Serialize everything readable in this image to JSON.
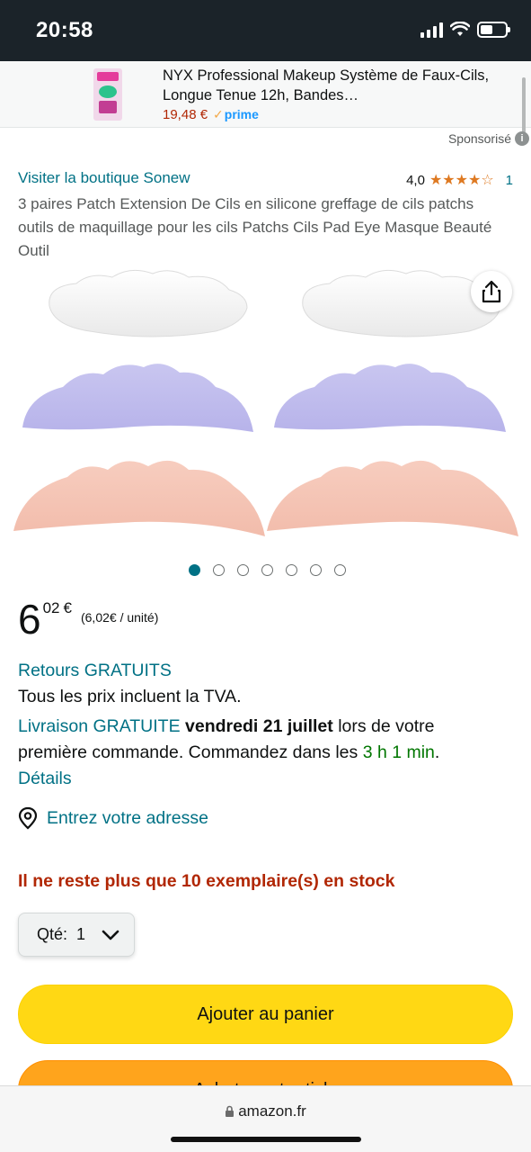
{
  "status_bar": {
    "time": "20:58"
  },
  "ad_banner": {
    "title": "NYX Professional Makeup Système de Faux-Cils, Longue Tenue 12h, Bandes…",
    "price": "19,48 €",
    "prime_label": "prime",
    "sponsored_label": "Sponsorisé"
  },
  "product": {
    "store_link": "Visiter la boutique Sonew",
    "rating_value": "4,0",
    "rating_stars": 4,
    "rating_count": "1",
    "title": "3 paires Patch Extension De Cils en silicone greffage de cils patchs outils de maquillage pour les cils Patchs Cils Pad Eye Masque Beauté Outil",
    "image_count": 7,
    "active_image_index": 0
  },
  "price": {
    "whole": "6",
    "fraction": "02",
    "currency": "€",
    "unit_price": "(6,02€ / unité)"
  },
  "returns": "Retours GRATUITS",
  "tax_note": "Tous les prix incluent la TVA.",
  "delivery": {
    "prefix": "Livraison GRATUITE",
    "date": "vendredi 21 juillet",
    "middle": "lors de votre",
    "line2": "première commande. Commandez dans les",
    "countdown": "3 h 1 min",
    "period": ".",
    "details_link": "Détails"
  },
  "address_link": "Entrez votre adresse",
  "stock_message": "Il ne reste plus que 10 exemplaire(s) en stock",
  "quantity": {
    "label": "Qté:",
    "value": "1"
  },
  "buttons": {
    "add_to_cart": "Ajouter au panier",
    "buy_now": "Acheter cet article"
  },
  "url_bar": {
    "domain": "amazon.fr"
  },
  "colors": {
    "link": "#007185",
    "price_red": "#b12704",
    "cart_yellow": "#ffd814",
    "buy_orange": "#ffa41c",
    "status_bar": "#1b2329"
  }
}
